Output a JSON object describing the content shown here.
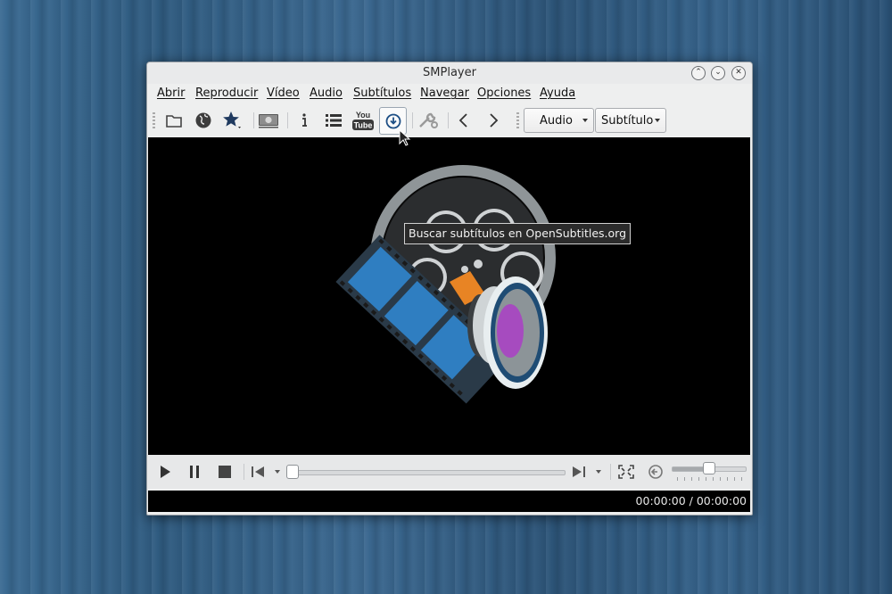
{
  "window": {
    "title": "SMPlayer"
  },
  "menu": [
    "Abrir",
    "Reproducir",
    "Vídeo",
    "Audio",
    "Subtítulos",
    "Navegar",
    "Opciones",
    "Ayuda"
  ],
  "toolbar": {
    "icons": [
      "folder-icon",
      "globe-icon",
      "favorites-star-icon",
      "screenshot-icon",
      "info-icon",
      "playlist-icon",
      "youtube-icon",
      "download-subtitles-icon",
      "preferences-tools-icon",
      "back-arrow-icon",
      "forward-arrow-icon"
    ],
    "youtube_label_top": "You",
    "youtube_label_bottom": "Tube",
    "audio_combo": "Audio",
    "subtitle_combo": "Subtítulo"
  },
  "tooltip": "Buscar subtítulos en OpenSubtitles.org",
  "controls": {
    "icons": [
      "play-icon",
      "pause-icon",
      "stop-icon",
      "previous-icon",
      "next-icon",
      "fullscreen-icon",
      "mute-icon"
    ],
    "seek_position": 0,
    "volume_level": 0.5
  },
  "status": {
    "time": "00:00:00 / 00:00:00"
  },
  "colors": {
    "video_bg": "#000000",
    "film_blue": "#2f7ec1",
    "orange": "#e88424",
    "lens_purple": "#a64bbf"
  }
}
